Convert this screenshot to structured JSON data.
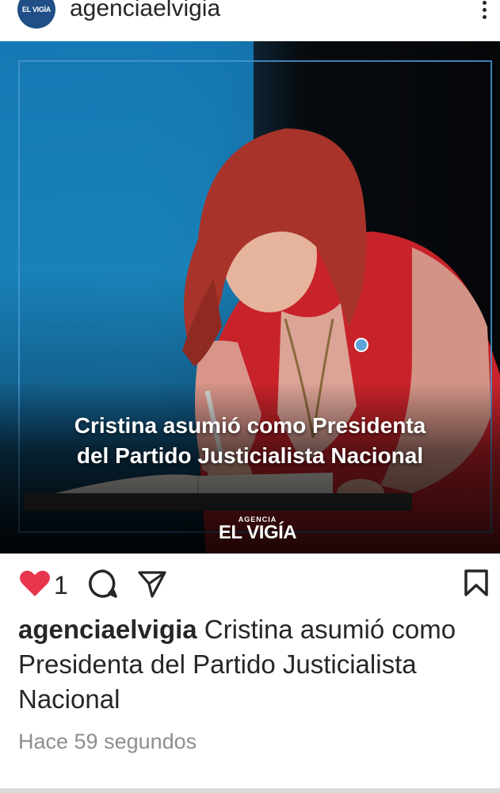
{
  "post": {
    "username": "agenciaelvigia",
    "avatar_label": "EL VIGÍA",
    "image": {
      "headline_line1": "Cristina asumió como Presidenta",
      "headline_line2": "del Partido Justicialista Nacional",
      "logo_small": "AGENCIA",
      "logo_big": "EL VIGÍA"
    },
    "likes": "1",
    "caption_author": "agenciaelvigia",
    "caption_text": "Cristina asumió como Presidenta del Partido Justicialista Nacional",
    "timestamp": "Hace 59 segundos"
  },
  "icons": {
    "like": "heart-icon",
    "comment": "comment-icon",
    "share": "send-icon",
    "save": "bookmark-icon",
    "more": "more-vertical-icon"
  },
  "colors": {
    "like_active": "#e8364e",
    "brand_blue": "#1f4f86"
  }
}
